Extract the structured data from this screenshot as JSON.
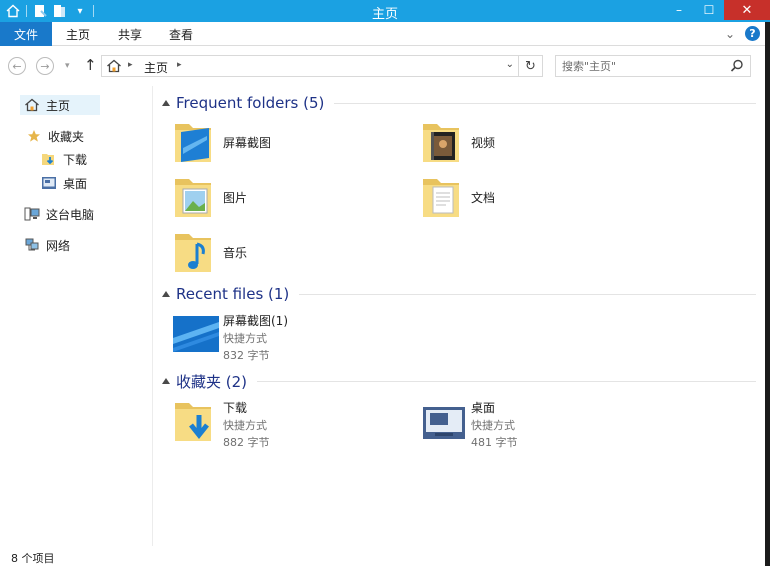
{
  "window": {
    "title": "主页",
    "accent": "#1ba1e2",
    "close_glyph": "✕",
    "minimize_glyph": "–",
    "maximize_glyph": "☐"
  },
  "quick_access": {
    "icons": [
      "home-icon",
      "properties-icon",
      "new-folder-icon",
      "customize-dropdown-icon"
    ],
    "dropdown_glyph": "▾"
  },
  "ribbon": {
    "file_tab": "文件",
    "tabs": [
      "主页",
      "共享",
      "查看"
    ],
    "expand_glyph": "⌄",
    "help_glyph": "?",
    "file_tab_color": "#1979ca"
  },
  "navigation": {
    "back_glyph": "←",
    "forward_glyph": "→",
    "recent_glyph": "▾",
    "up_glyph": "↑",
    "breadcrumb": [
      "主页"
    ],
    "breadcrumb_arrow": "▸",
    "dropdown_glyph": "⌄",
    "refresh_glyph": "↻"
  },
  "search": {
    "placeholder": "搜索\"主页\""
  },
  "sidebar": {
    "items": [
      {
        "label": "主页",
        "icon": "home-icon",
        "selected": true
      },
      {
        "label": "收藏夹",
        "icon": "star-icon",
        "selected": false
      },
      {
        "label": "下载",
        "icon": "downloads-icon",
        "selected": false
      },
      {
        "label": "桌面",
        "icon": "desktop-icon",
        "selected": false
      },
      {
        "label": "这台电脑",
        "icon": "computer-icon",
        "selected": false
      },
      {
        "label": "网络",
        "icon": "network-icon",
        "selected": false
      }
    ]
  },
  "groups": [
    {
      "title": "Frequent folders (5)",
      "items": [
        {
          "name": "屏幕截图",
          "icon": "screenshots-folder-icon"
        },
        {
          "name": "视频",
          "icon": "videos-folder-icon"
        },
        {
          "name": "图片",
          "icon": "pictures-folder-icon"
        },
        {
          "name": "文档",
          "icon": "documents-folder-icon"
        },
        {
          "name": "音乐",
          "icon": "music-folder-icon"
        }
      ]
    },
    {
      "title": "Recent files (1)",
      "items": [
        {
          "name": "屏幕截图(1)",
          "type": "快捷方式",
          "size": "832 字节",
          "icon": "screenshot-thumbnail-icon"
        }
      ]
    },
    {
      "title": "收藏夹 (2)",
      "items": [
        {
          "name": "下载",
          "type": "快捷方式",
          "size": "882 字节",
          "icon": "downloads-folder-icon"
        },
        {
          "name": "桌面",
          "type": "快捷方式",
          "size": "481 字节",
          "icon": "desktop-shortcut-icon"
        }
      ]
    }
  ],
  "statusbar": {
    "item_count": "8 个项目"
  },
  "colors": {
    "group_title": "#1e3287",
    "folder_yellow": "#f5d77b",
    "selected_bg": "#e5f3fb"
  }
}
